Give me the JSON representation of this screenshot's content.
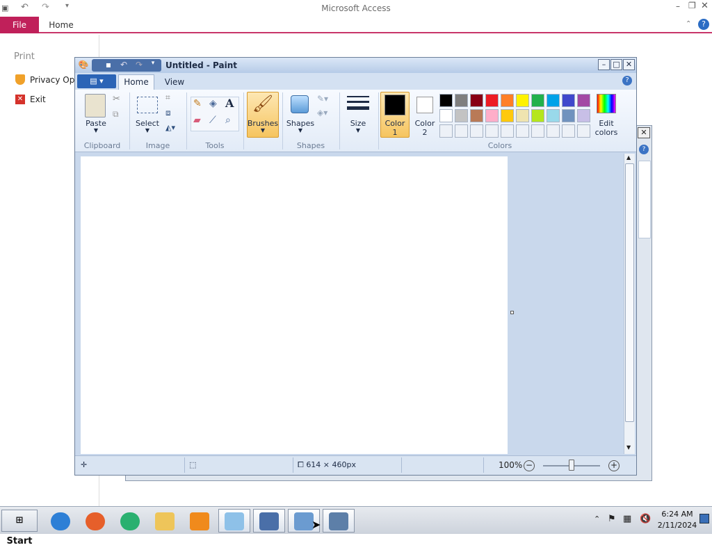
{
  "access": {
    "title": "Microsoft Access",
    "tabs": {
      "file": "File",
      "home": "Home"
    },
    "backstage": {
      "print": "Print",
      "privacy": "Privacy Optic",
      "exit": "Exit"
    }
  },
  "paint": {
    "title": "Untitled - Paint",
    "tabs": {
      "home": "Home",
      "view": "View"
    },
    "ribbon": {
      "clipboard": {
        "label": "Clipboard",
        "paste": "Paste"
      },
      "image": {
        "label": "Image",
        "select": "Select"
      },
      "tools": {
        "label": "Tools"
      },
      "brushes": "Brushes",
      "shapes": {
        "label": "Shapes",
        "button": "Shapes"
      },
      "size": "Size",
      "color1": {
        "line1": "Color",
        "line2": "1"
      },
      "color2": {
        "line1": "Color",
        "line2": "2"
      },
      "colors": {
        "label": "Colors",
        "edit_line1": "Edit",
        "edit_line2": "colors"
      }
    },
    "palette_row1": [
      "#000000",
      "#7f7f7f",
      "#880015",
      "#ed1c24",
      "#ff7f27",
      "#fff200",
      "#22b14c",
      "#00a2e8",
      "#3f48cc",
      "#a349a4"
    ],
    "palette_row2": [
      "#ffffff",
      "#c3c3c3",
      "#b97a57",
      "#ffaec9",
      "#ffc90e",
      "#efe4b0",
      "#b5e61d",
      "#99d9ea",
      "#7092be",
      "#c8bfe7"
    ],
    "status": {
      "size": "614 × 460px",
      "zoom": "100%"
    }
  },
  "taskbar": {
    "start": "Start",
    "time": "6:24 AM",
    "date": "2/11/2024"
  }
}
